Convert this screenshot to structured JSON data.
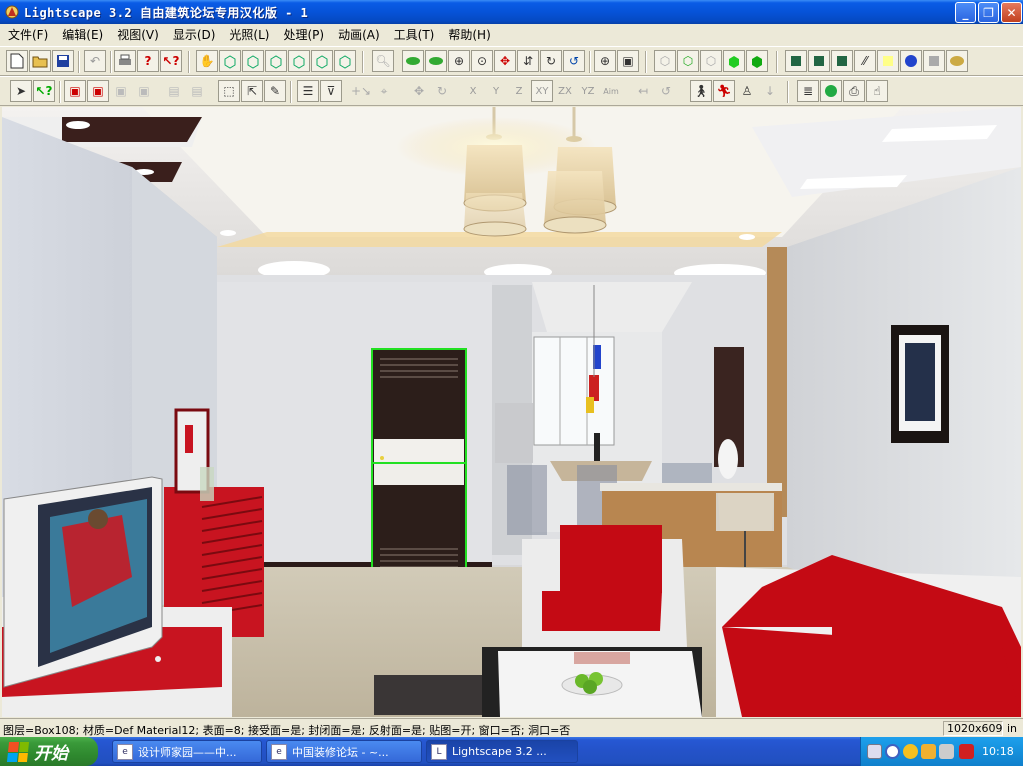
{
  "window": {
    "title": "Lightscape 3.2 自由建筑论坛专用汉化版  - 1",
    "min_glyph": "_",
    "max_glyph": "❐",
    "close_glyph": "✕"
  },
  "menu": [
    {
      "label": "文件(F)"
    },
    {
      "label": "编辑(E)"
    },
    {
      "label": "视图(V)"
    },
    {
      "label": "显示(D)"
    },
    {
      "label": "光照(L)"
    },
    {
      "label": "处理(P)"
    },
    {
      "label": "动画(A)"
    },
    {
      "label": "工具(T)"
    },
    {
      "label": "帮助(H)"
    }
  ],
  "toolbar_axes": {
    "x": "X",
    "y": "Y",
    "z": "Z",
    "xy": "XY",
    "zx": "ZX",
    "yz": "YZ",
    "aim": "Aim"
  },
  "status": {
    "text": "图层=Box108; 材质=Def Material12; 表面=8; 接受面=是; 封闭面=是; 反射面=是; 贴图=开; 窗口=否; 洞口=否",
    "size": "1020x609",
    "extra": "in"
  },
  "taskbar": {
    "start_label": "开始",
    "tasks": [
      {
        "label": "设计师家园——中..."
      },
      {
        "label": "中国装修论坛 - ~..."
      },
      {
        "label": "Lightscape 3.2 ..."
      }
    ],
    "clock": "10:18"
  },
  "colors": {
    "titlebar": "#0653d8",
    "taskbar": "#2452c8",
    "start": "#3a9a3a",
    "selection": "#22e022",
    "sofa_red": "#c8101a"
  }
}
